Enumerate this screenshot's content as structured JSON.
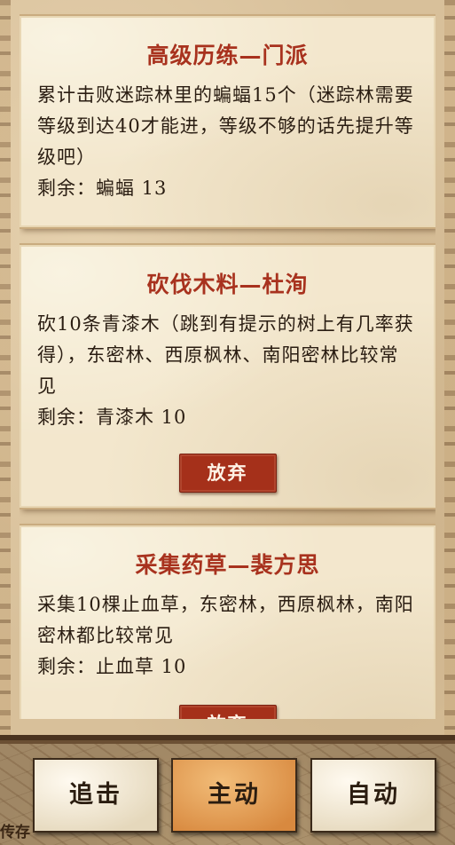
{
  "tasks": [
    {
      "title": "高级历练—门派",
      "desc": "累计击败迷踪林里的蝙蝠15个（迷踪林需要等级到达40才能进，等级不够的话先提升等级吧）",
      "remain": "剩余：蝙蝠 13"
    },
    {
      "title": "砍伐木料—杜洵",
      "desc": "砍10条青漆木（跳到有提示的树上有几率获得），东密林、西原枫林、南阳密林比较常见",
      "remain": "剩余：青漆木 10",
      "button": "放弃"
    },
    {
      "title": "采集药草—裴方思",
      "desc": "采集10棵止血草，东密林，西原枫林，南阳密林都比较常见",
      "remain": "剩余：止血草 10",
      "button": "放弃"
    }
  ],
  "bottom": {
    "map_label": "传存",
    "buttons": [
      {
        "label": "追击",
        "active": false
      },
      {
        "label": "主动",
        "active": true
      },
      {
        "label": "自动",
        "active": false
      }
    ]
  }
}
